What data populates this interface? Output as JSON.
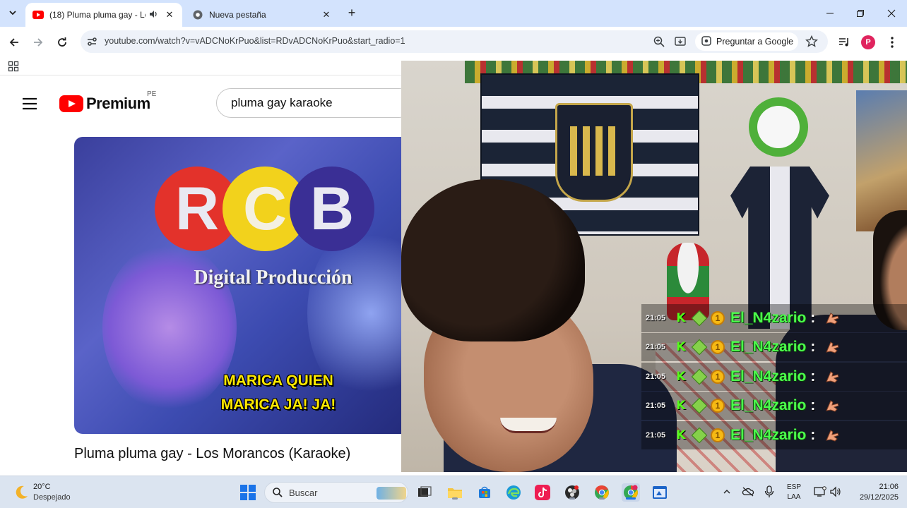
{
  "browser": {
    "tabs": [
      {
        "title": "(18) Pluma pluma gay - Los",
        "active": true,
        "favicon": "youtube-icon",
        "audio": true
      },
      {
        "title": "Nueva pestaña",
        "active": false,
        "favicon": "chrome-icon",
        "audio": false
      }
    ],
    "url": "youtube.com/watch?v=vADCNoKrPuo&list=RDvADCNoKrPuo&start_radio=1",
    "ask_google_label": "Preguntar a Google",
    "profile_initial": "P",
    "colors": {
      "tabstrip": "#d3e3fd",
      "profile": "#e0245e"
    }
  },
  "youtube": {
    "brand": "Premium",
    "country": "PE",
    "search_value": "pluma gay karaoke",
    "video": {
      "logo_letters": [
        "R",
        "C",
        "B"
      ],
      "logo_subtitle": "Digital Producción",
      "lyric_line1": "MARICA QUIEN",
      "lyric_line2": "MARICA JA! JA!"
    },
    "video_title": "Pluma pluma gay - Los Morancos (Karaoke)"
  },
  "chat": {
    "messages": [
      {
        "time": "21:05",
        "badge_k": "K",
        "badge_coin": "1",
        "user": "El_N4zario",
        "sep": ":"
      },
      {
        "time": "21:05",
        "badge_k": "K",
        "badge_coin": "1",
        "user": "El_N4zario",
        "sep": ":"
      },
      {
        "time": "21:05",
        "badge_k": "K",
        "badge_coin": "1",
        "user": "El_N4zario",
        "sep": ":"
      },
      {
        "time": "21:05",
        "badge_k": "K",
        "badge_coin": "1",
        "user": "El_N4zario",
        "sep": ":"
      },
      {
        "time": "21:05",
        "badge_k": "K",
        "badge_coin": "1",
        "user": "El_N4zario",
        "sep": ":"
      }
    ]
  },
  "taskbar": {
    "weather_temp": "20°C",
    "weather_desc": "Despejado",
    "search_placeholder": "Buscar",
    "lang_line1": "ESP",
    "lang_line2": "LAA",
    "time": "21:06",
    "date": "29/12/2025"
  }
}
